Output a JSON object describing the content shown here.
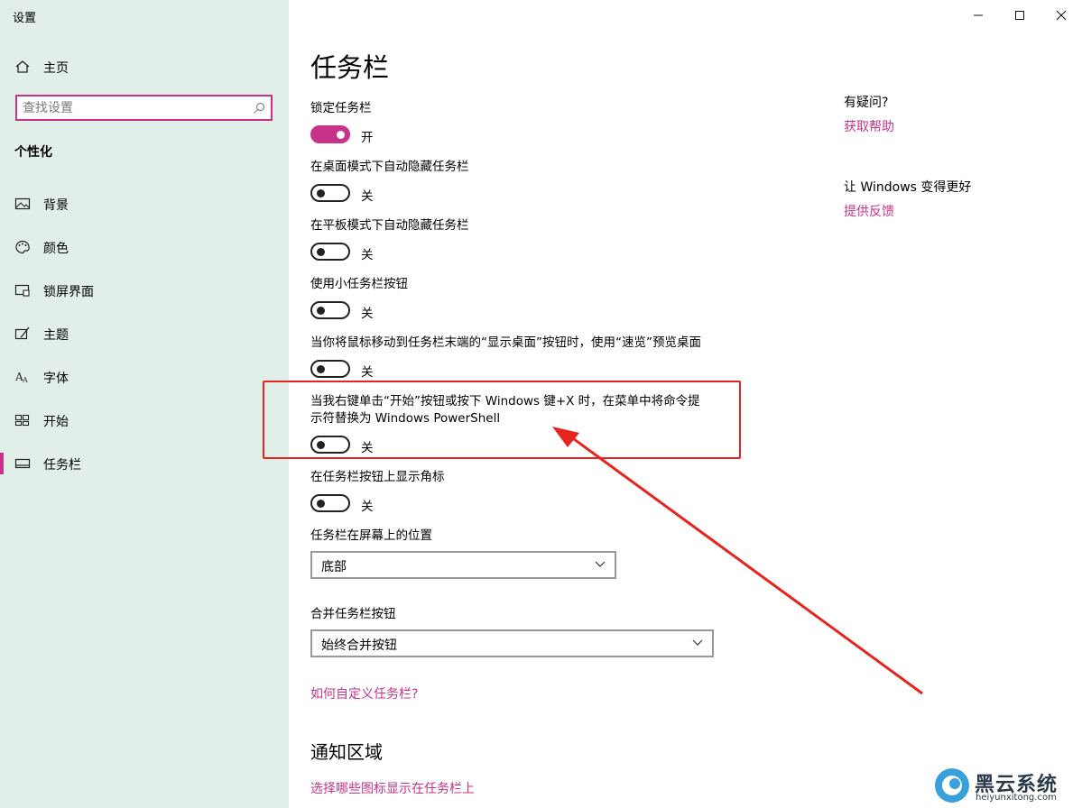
{
  "window": {
    "title": "设置",
    "controls": [
      "minimize-icon",
      "maximize-icon",
      "close-icon"
    ]
  },
  "sidebar": {
    "home_label": "主页",
    "search_placeholder": "查找设置",
    "section_title": "个性化",
    "items": [
      {
        "label": "背景",
        "icon": "picture-icon",
        "active": false
      },
      {
        "label": "颜色",
        "icon": "palette-icon",
        "active": false
      },
      {
        "label": "锁屏界面",
        "icon": "lockscreen-icon",
        "active": false
      },
      {
        "label": "主题",
        "icon": "theme-brush-icon",
        "active": false
      },
      {
        "label": "字体",
        "icon": "font-icon",
        "active": false
      },
      {
        "label": "开始",
        "icon": "start-grid-icon",
        "active": false
      },
      {
        "label": "任务栏",
        "icon": "taskbar-icon",
        "active": true
      }
    ]
  },
  "main": {
    "title": "任务栏",
    "settings": [
      {
        "label": "锁定任务栏",
        "state": "开",
        "on": true
      },
      {
        "label": "在桌面模式下自动隐藏任务栏",
        "state": "关",
        "on": false
      },
      {
        "label": "在平板模式下自动隐藏任务栏",
        "state": "关",
        "on": false
      },
      {
        "label": "使用小任务栏按钮",
        "state": "关",
        "on": false
      },
      {
        "label": "当你将鼠标移动到任务栏末端的“显示桌面”按钮时，使用“速览”预览桌面",
        "state": "关",
        "on": false
      },
      {
        "label": "当我右键单击“开始”按钮或按下 Windows 键+X 时，在菜单中将命令提示符替换为 Windows PowerShell",
        "state": "关",
        "on": false
      },
      {
        "label": "在任务栏按钮上显示角标",
        "state": "关",
        "on": false
      }
    ],
    "position_label": "任务栏在屏幕上的位置",
    "position_value": "底部",
    "combine_label": "合并任务栏按钮",
    "combine_value": "始终合并按钮",
    "customize_link": "如何自定义任务栏?",
    "notification_title": "通知区域",
    "notification_link": "选择哪些图标显示在任务栏上"
  },
  "right_pane": {
    "question": "有疑问?",
    "help_link": "获取帮助",
    "improve": "让 Windows 变得更好",
    "feedback_link": "提供反馈"
  },
  "annotations": {
    "highlight_color": "#e6241d",
    "accent_color": "#c8338a"
  },
  "watermark": {
    "brand": "黑云系统",
    "url": "heiyunxitong.com"
  }
}
